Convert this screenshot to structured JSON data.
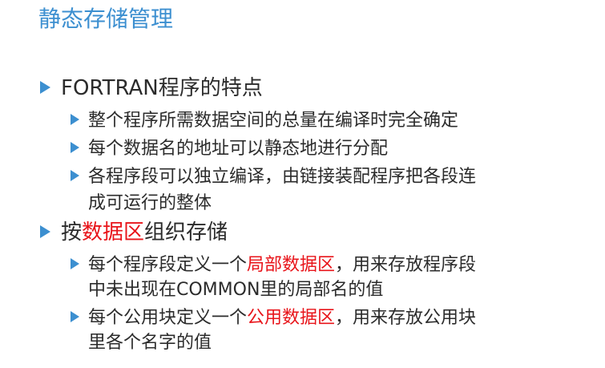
{
  "title": "静态存储管理",
  "section1": {
    "heading": "FORTRAN程序的特点",
    "items": [
      "整个程序所需数据空间的总量在编译时完全确定",
      "每个数据名的地址可以静态地进行分配",
      "各程序段可以独立编译，由链接装配程序把各段连",
      "成可运行的整体"
    ]
  },
  "section2": {
    "heading_prefix": "按",
    "heading_highlight": "数据区",
    "heading_suffix": "组织存储",
    "item1": {
      "prefix": "每个程序段定义一个",
      "highlight": "局部数据区",
      "suffix": "，用来存放程序段",
      "cont": "中未出现在COMMON里的局部名的值"
    },
    "item2": {
      "prefix": "每个公用块定义一个",
      "highlight": "公用数据区",
      "suffix": "，用来存放公用块",
      "cont": "里各个名字的值"
    }
  },
  "colors": {
    "accent": "#3c8fd0",
    "highlight": "#e8141a",
    "text": "#2b2b2b"
  }
}
